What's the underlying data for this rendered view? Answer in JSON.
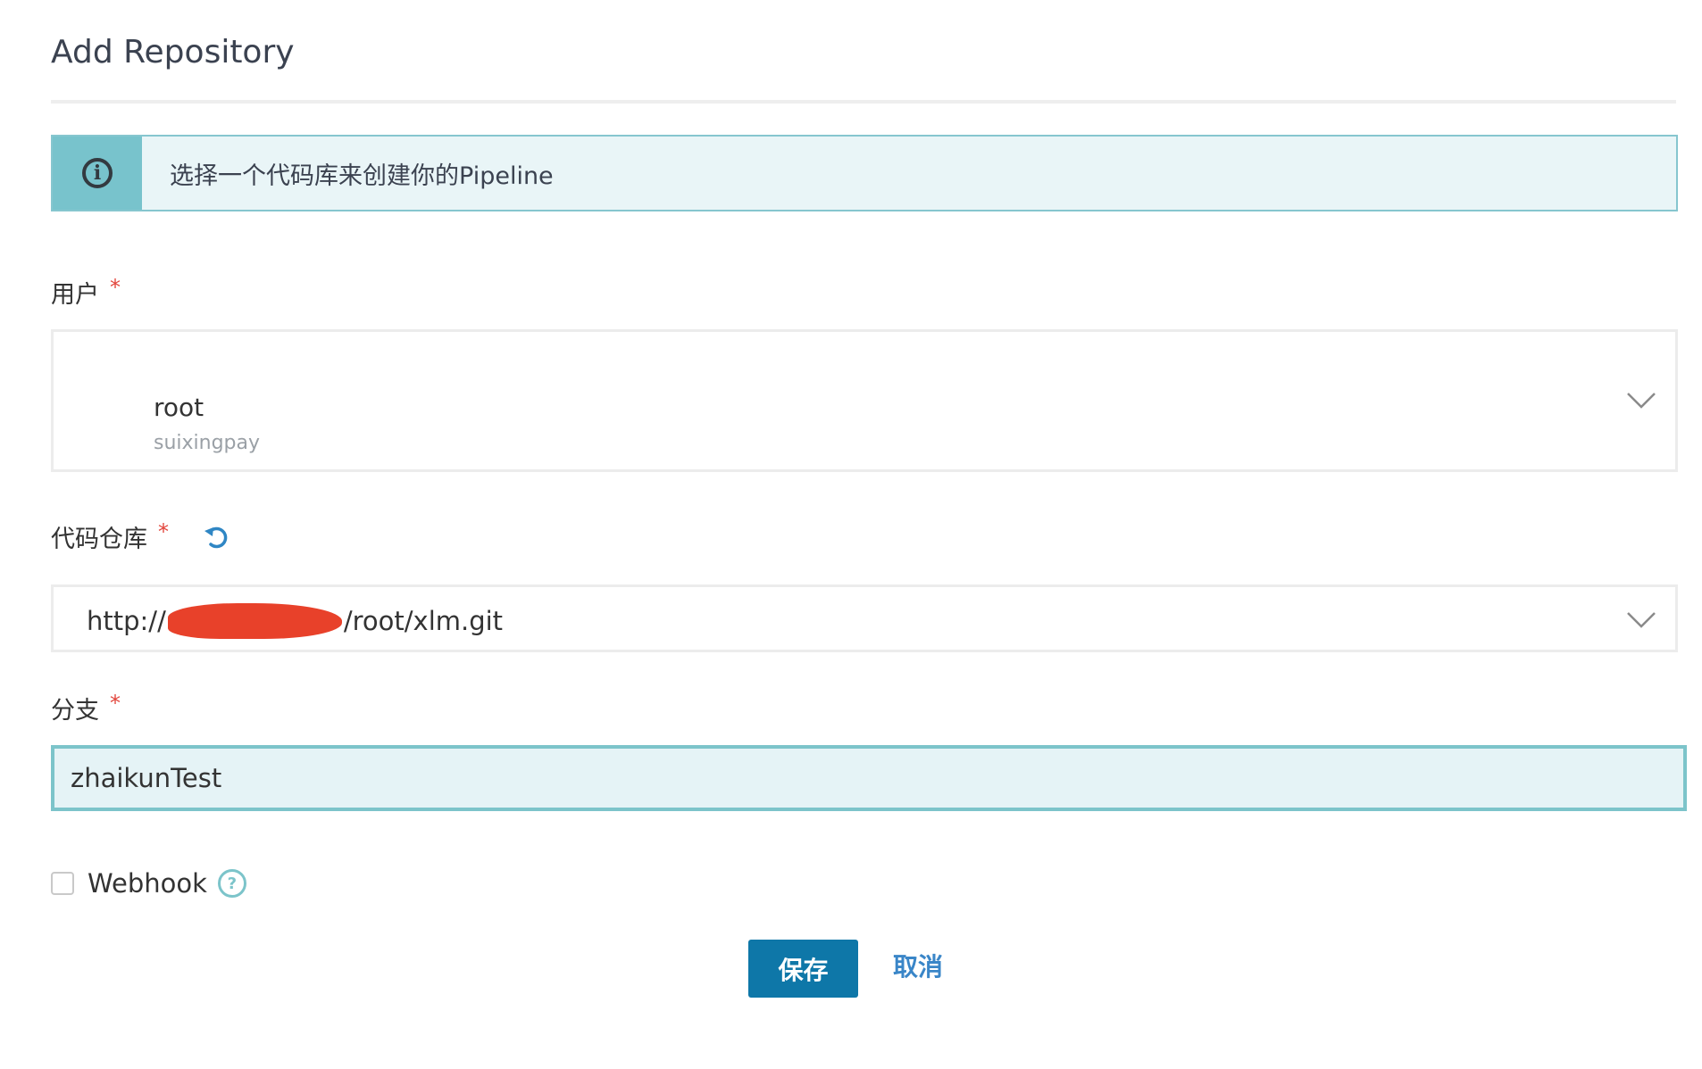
{
  "page": {
    "title": "Add Repository"
  },
  "info_banner": {
    "icon": "info-circle-icon",
    "text": "选择一个代码库来创建你的Pipeline"
  },
  "form": {
    "user": {
      "label": "用户",
      "required_mark": "*",
      "selected_name": "root",
      "selected_org": "suixingpay"
    },
    "repository": {
      "label": "代码仓库",
      "required_mark": "*",
      "refresh_icon": "refresh-icon",
      "value_prefix": "http://",
      "value_suffix": "/root/xlm.git",
      "redacted": true
    },
    "branch": {
      "label": "分支",
      "required_mark": "*",
      "value": "zhaikunTest"
    },
    "webhook": {
      "label": "Webhook",
      "checked": false,
      "help_icon": "question-circle-icon"
    }
  },
  "actions": {
    "save_label": "保存",
    "cancel_label": "取消"
  },
  "colors": {
    "primary": "#0e77a8",
    "info_accent": "#78c3cc",
    "info_bg": "#e9f5f7",
    "required": "#e2453c",
    "link": "#3a86c8"
  }
}
